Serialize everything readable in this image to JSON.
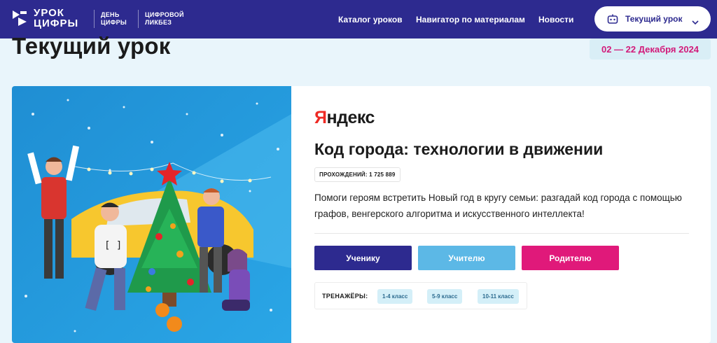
{
  "header": {
    "logo_line1": "УРОК",
    "logo_line2": "ЦИФРЫ",
    "sub1_line1": "ДЕНЬ",
    "sub1_line2": "ЦИФРЫ",
    "sub2_line1": "ЦИФРОВОЙ",
    "sub2_line2": "ЛИКБЕЗ",
    "nav": [
      "Каталог уроков",
      "Навигатор по материалам",
      "Новости"
    ],
    "current_lesson_button": "Текущий урок",
    "icons": {
      "current": "robot-icon",
      "chevron": "chevron-down-icon"
    }
  },
  "page": {
    "title": "Текущий урок",
    "date_range": "02 — 22 Декабря 2024"
  },
  "lesson": {
    "brand_first": "Я",
    "brand_rest": "ндекс",
    "title": "Код города: технологии в движении",
    "passes": "ПРОХОЖДЕНИЙ: 1 725 889",
    "description": "Помоги героям встретить Новый год в кругу семьи: разгадай код города с помощью графов, венгерского алгоритма и искусственного интеллекта!",
    "buttons": {
      "student": "Ученику",
      "teacher": "Учителю",
      "parent": "Родителю"
    },
    "trainers_label": "ТРЕНАЖЁРЫ:",
    "trainers": [
      "1-4 класс",
      "5-9 класс",
      "10-11 класс"
    ]
  },
  "colors": {
    "header_bg": "#2d2a8f",
    "accent_pink": "#e0197a",
    "accent_light_blue": "#5cb8e6",
    "brand_red": "#ee2a24"
  }
}
